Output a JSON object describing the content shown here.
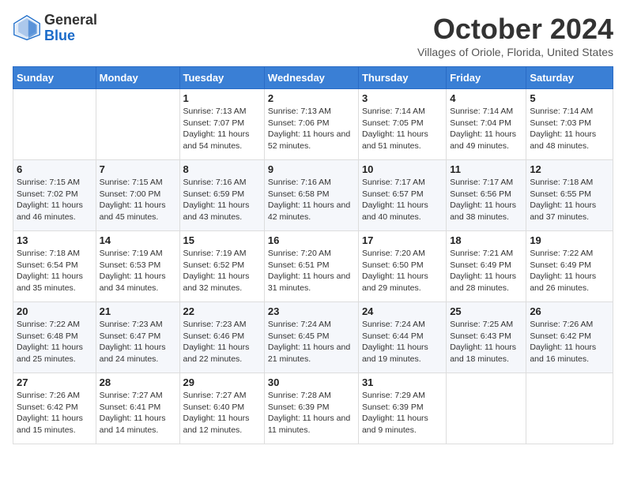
{
  "logo": {
    "general": "General",
    "blue": "Blue"
  },
  "title": "October 2024",
  "location": "Villages of Oriole, Florida, United States",
  "days_of_week": [
    "Sunday",
    "Monday",
    "Tuesday",
    "Wednesday",
    "Thursday",
    "Friday",
    "Saturday"
  ],
  "weeks": [
    [
      {
        "day": "",
        "info": ""
      },
      {
        "day": "",
        "info": ""
      },
      {
        "day": "1",
        "sunrise": "Sunrise: 7:13 AM",
        "sunset": "Sunset: 7:07 PM",
        "daylight": "Daylight: 11 hours and 54 minutes."
      },
      {
        "day": "2",
        "sunrise": "Sunrise: 7:13 AM",
        "sunset": "Sunset: 7:06 PM",
        "daylight": "Daylight: 11 hours and 52 minutes."
      },
      {
        "day": "3",
        "sunrise": "Sunrise: 7:14 AM",
        "sunset": "Sunset: 7:05 PM",
        "daylight": "Daylight: 11 hours and 51 minutes."
      },
      {
        "day": "4",
        "sunrise": "Sunrise: 7:14 AM",
        "sunset": "Sunset: 7:04 PM",
        "daylight": "Daylight: 11 hours and 49 minutes."
      },
      {
        "day": "5",
        "sunrise": "Sunrise: 7:14 AM",
        "sunset": "Sunset: 7:03 PM",
        "daylight": "Daylight: 11 hours and 48 minutes."
      }
    ],
    [
      {
        "day": "6",
        "sunrise": "Sunrise: 7:15 AM",
        "sunset": "Sunset: 7:02 PM",
        "daylight": "Daylight: 11 hours and 46 minutes."
      },
      {
        "day": "7",
        "sunrise": "Sunrise: 7:15 AM",
        "sunset": "Sunset: 7:00 PM",
        "daylight": "Daylight: 11 hours and 45 minutes."
      },
      {
        "day": "8",
        "sunrise": "Sunrise: 7:16 AM",
        "sunset": "Sunset: 6:59 PM",
        "daylight": "Daylight: 11 hours and 43 minutes."
      },
      {
        "day": "9",
        "sunrise": "Sunrise: 7:16 AM",
        "sunset": "Sunset: 6:58 PM",
        "daylight": "Daylight: 11 hours and 42 minutes."
      },
      {
        "day": "10",
        "sunrise": "Sunrise: 7:17 AM",
        "sunset": "Sunset: 6:57 PM",
        "daylight": "Daylight: 11 hours and 40 minutes."
      },
      {
        "day": "11",
        "sunrise": "Sunrise: 7:17 AM",
        "sunset": "Sunset: 6:56 PM",
        "daylight": "Daylight: 11 hours and 38 minutes."
      },
      {
        "day": "12",
        "sunrise": "Sunrise: 7:18 AM",
        "sunset": "Sunset: 6:55 PM",
        "daylight": "Daylight: 11 hours and 37 minutes."
      }
    ],
    [
      {
        "day": "13",
        "sunrise": "Sunrise: 7:18 AM",
        "sunset": "Sunset: 6:54 PM",
        "daylight": "Daylight: 11 hours and 35 minutes."
      },
      {
        "day": "14",
        "sunrise": "Sunrise: 7:19 AM",
        "sunset": "Sunset: 6:53 PM",
        "daylight": "Daylight: 11 hours and 34 minutes."
      },
      {
        "day": "15",
        "sunrise": "Sunrise: 7:19 AM",
        "sunset": "Sunset: 6:52 PM",
        "daylight": "Daylight: 11 hours and 32 minutes."
      },
      {
        "day": "16",
        "sunrise": "Sunrise: 7:20 AM",
        "sunset": "Sunset: 6:51 PM",
        "daylight": "Daylight: 11 hours and 31 minutes."
      },
      {
        "day": "17",
        "sunrise": "Sunrise: 7:20 AM",
        "sunset": "Sunset: 6:50 PM",
        "daylight": "Daylight: 11 hours and 29 minutes."
      },
      {
        "day": "18",
        "sunrise": "Sunrise: 7:21 AM",
        "sunset": "Sunset: 6:49 PM",
        "daylight": "Daylight: 11 hours and 28 minutes."
      },
      {
        "day": "19",
        "sunrise": "Sunrise: 7:22 AM",
        "sunset": "Sunset: 6:49 PM",
        "daylight": "Daylight: 11 hours and 26 minutes."
      }
    ],
    [
      {
        "day": "20",
        "sunrise": "Sunrise: 7:22 AM",
        "sunset": "Sunset: 6:48 PM",
        "daylight": "Daylight: 11 hours and 25 minutes."
      },
      {
        "day": "21",
        "sunrise": "Sunrise: 7:23 AM",
        "sunset": "Sunset: 6:47 PM",
        "daylight": "Daylight: 11 hours and 24 minutes."
      },
      {
        "day": "22",
        "sunrise": "Sunrise: 7:23 AM",
        "sunset": "Sunset: 6:46 PM",
        "daylight": "Daylight: 11 hours and 22 minutes."
      },
      {
        "day": "23",
        "sunrise": "Sunrise: 7:24 AM",
        "sunset": "Sunset: 6:45 PM",
        "daylight": "Daylight: 11 hours and 21 minutes."
      },
      {
        "day": "24",
        "sunrise": "Sunrise: 7:24 AM",
        "sunset": "Sunset: 6:44 PM",
        "daylight": "Daylight: 11 hours and 19 minutes."
      },
      {
        "day": "25",
        "sunrise": "Sunrise: 7:25 AM",
        "sunset": "Sunset: 6:43 PM",
        "daylight": "Daylight: 11 hours and 18 minutes."
      },
      {
        "day": "26",
        "sunrise": "Sunrise: 7:26 AM",
        "sunset": "Sunset: 6:42 PM",
        "daylight": "Daylight: 11 hours and 16 minutes."
      }
    ],
    [
      {
        "day": "27",
        "sunrise": "Sunrise: 7:26 AM",
        "sunset": "Sunset: 6:42 PM",
        "daylight": "Daylight: 11 hours and 15 minutes."
      },
      {
        "day": "28",
        "sunrise": "Sunrise: 7:27 AM",
        "sunset": "Sunset: 6:41 PM",
        "daylight": "Daylight: 11 hours and 14 minutes."
      },
      {
        "day": "29",
        "sunrise": "Sunrise: 7:27 AM",
        "sunset": "Sunset: 6:40 PM",
        "daylight": "Daylight: 11 hours and 12 minutes."
      },
      {
        "day": "30",
        "sunrise": "Sunrise: 7:28 AM",
        "sunset": "Sunset: 6:39 PM",
        "daylight": "Daylight: 11 hours and 11 minutes."
      },
      {
        "day": "31",
        "sunrise": "Sunrise: 7:29 AM",
        "sunset": "Sunset: 6:39 PM",
        "daylight": "Daylight: 11 hours and 9 minutes."
      },
      {
        "day": "",
        "info": ""
      },
      {
        "day": "",
        "info": ""
      }
    ]
  ]
}
